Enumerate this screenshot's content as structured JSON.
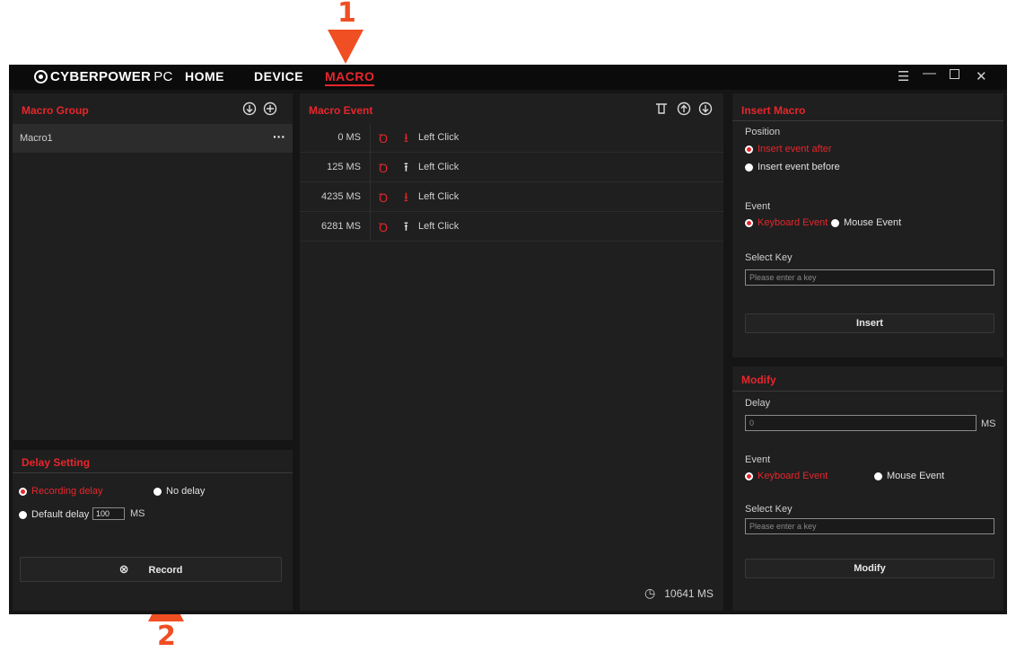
{
  "callouts": {
    "one": "1",
    "two": "2"
  },
  "titlebar": {
    "logo_main": "CYBERPOWER",
    "logo_pc": "PC",
    "nav": [
      "HOME",
      "DEVICE",
      "MACRO"
    ],
    "active_nav": "MACRO"
  },
  "macro_group": {
    "title": "Macro Group",
    "items": [
      {
        "name": "Macro1",
        "menu": "···"
      }
    ]
  },
  "delay_setting": {
    "title": "Delay Setting",
    "recording_delay": "Recording delay",
    "no_delay": "No delay",
    "default_delay": "Default delay",
    "default_delay_value": "100",
    "unit": "MS",
    "record_label": "Record"
  },
  "macro_event": {
    "title": "Macro Event",
    "events": [
      {
        "time": "0 MS",
        "direction": "down",
        "label": "Left Click"
      },
      {
        "time": "125 MS",
        "direction": "up",
        "label": "Left Click"
      },
      {
        "time": "4235 MS",
        "direction": "down",
        "label": "Left Click"
      },
      {
        "time": "6281 MS",
        "direction": "up",
        "label": "Left Click"
      }
    ],
    "total": "10641 MS"
  },
  "insert_macro": {
    "title": "Insert Macro",
    "position_label": "Position",
    "insert_after": "Insert event after",
    "insert_before": "Insert event before",
    "event_label": "Event",
    "keyboard_event": "Keyboard Event",
    "mouse_event": "Mouse Event",
    "select_key_label": "Select Key",
    "select_key_placeholder": "Please enter a key",
    "insert_button": "Insert"
  },
  "modify": {
    "title": "Modify",
    "delay_label": "Delay",
    "delay_value": "0",
    "unit": "MS",
    "event_label": "Event",
    "keyboard_event": "Keyboard Event",
    "mouse_event": "Mouse Event",
    "select_key_label": "Select Key",
    "select_key_placeholder": "Please enter a key",
    "modify_button": "Modify"
  },
  "colors": {
    "accent": "#e8262c",
    "callout": "#f04e23",
    "background": "#151515",
    "panel": "#1f1f1f"
  }
}
